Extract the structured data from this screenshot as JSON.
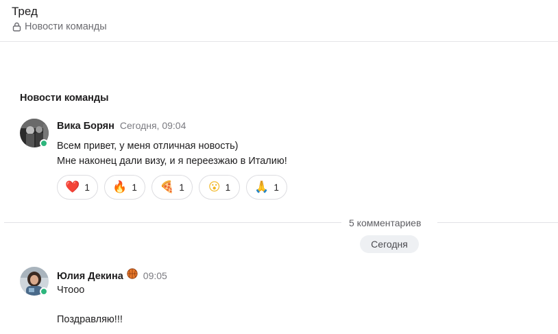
{
  "header": {
    "title": "Тред",
    "channel": "Новости команды",
    "lock_icon": "lock-icon"
  },
  "thread": {
    "channel_heading": "Новости команды",
    "root_message": {
      "author": "Вика Борян",
      "time": "Сегодня, 09:04",
      "lines": [
        "Всем привет, у меня отличная новость)",
        "Мне наконец дали визу, и я переезжаю в Италию!"
      ],
      "online": true,
      "reactions": [
        {
          "emoji": "❤️",
          "icon": "heart-icon",
          "count": "1"
        },
        {
          "emoji": "🔥",
          "icon": "fire-icon",
          "count": "1"
        },
        {
          "emoji": "🍕",
          "icon": "pizza-icon",
          "count": "1"
        },
        {
          "emoji": "😮",
          "icon": "surprised-face-icon",
          "count": "1"
        },
        {
          "emoji": "🙏",
          "icon": "folded-hands-icon",
          "count": "1"
        }
      ]
    },
    "comments_divider": "5 комментариев",
    "day_label": "Сегодня",
    "reply": {
      "author": "Юлия Декина",
      "status_icon": "basketball-icon",
      "time": "09:05",
      "lines": [
        "Чтооо",
        "Поздравляю!!!"
      ],
      "online": true
    }
  },
  "colors": {
    "online": "#2eb67d",
    "divider": "#e2e2e6",
    "pill_bg": "#eef0f3"
  }
}
